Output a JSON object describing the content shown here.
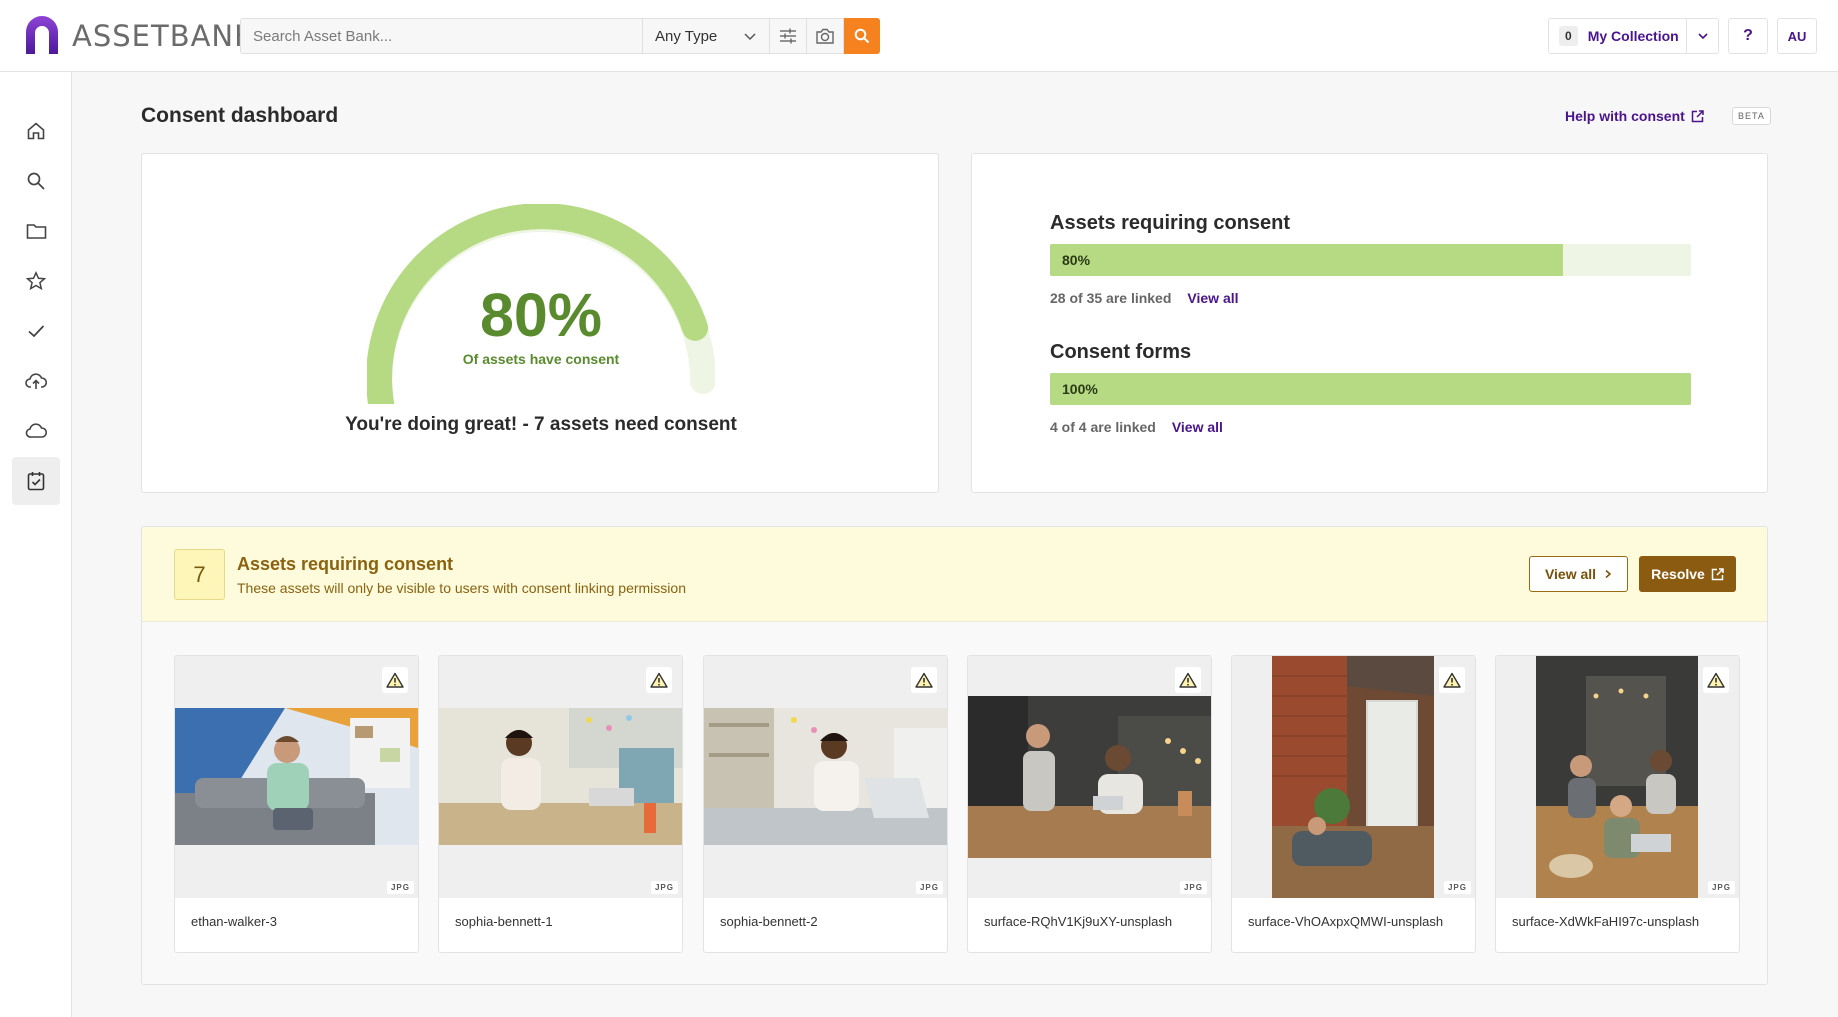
{
  "app": {
    "logo_text": "ASSETBANK",
    "brand_color": "#7b2fbe",
    "accent_color": "#f5821f"
  },
  "search": {
    "placeholder": "Search Asset Bank...",
    "value": "",
    "type_selected": "Any Type"
  },
  "header_right": {
    "collection_count": "0",
    "collection_label": "My Collection",
    "help_label": "?",
    "user_initials": "AU"
  },
  "sidebar": {
    "items": [
      {
        "icon": "home-icon"
      },
      {
        "icon": "search-icon"
      },
      {
        "icon": "folder-icon"
      },
      {
        "icon": "star-icon"
      },
      {
        "icon": "check-icon"
      },
      {
        "icon": "cloud-upload-icon"
      },
      {
        "icon": "cloud-icon"
      },
      {
        "icon": "consent-clipboard-icon",
        "active": true
      }
    ]
  },
  "page": {
    "title": "Consent dashboard",
    "help_link": "Help with consent",
    "beta_badge": "BETA"
  },
  "gauge": {
    "percent_label": "80%",
    "percent_value": 0.8,
    "subtitle": "Of assets have consent",
    "message": "You're doing great!  -  7 assets need consent",
    "fill_color": "#b6da83",
    "track_color": "#eef5e4"
  },
  "stats": {
    "assets": {
      "title": "Assets requiring consent",
      "percent_label": "80%",
      "percent_value": 0.8,
      "meta": "28 of 35 are linked",
      "link": "View all"
    },
    "forms": {
      "title": "Consent forms",
      "percent_label": "100%",
      "percent_value": 1.0,
      "meta": "4 of 4 are linked",
      "link": "View all"
    }
  },
  "consent_panel": {
    "count": "7",
    "title": "Assets requiring consent",
    "description": "These assets will only be visible to users with consent linking permission",
    "view_all_label": "View all",
    "resolve_label": "Resolve",
    "assets": [
      {
        "name": "ethan-walker-3",
        "type": "JPG"
      },
      {
        "name": "sophia-bennett-1",
        "type": "JPG"
      },
      {
        "name": "sophia-bennett-2",
        "type": "JPG"
      },
      {
        "name": "surface-RQhV1Kj9uXY-unsplash",
        "type": "JPG"
      },
      {
        "name": "surface-VhOAxpxQMWI-unsplash",
        "type": "JPG"
      },
      {
        "name": "surface-XdWkFaHI97c-unsplash",
        "type": "JPG"
      }
    ]
  }
}
